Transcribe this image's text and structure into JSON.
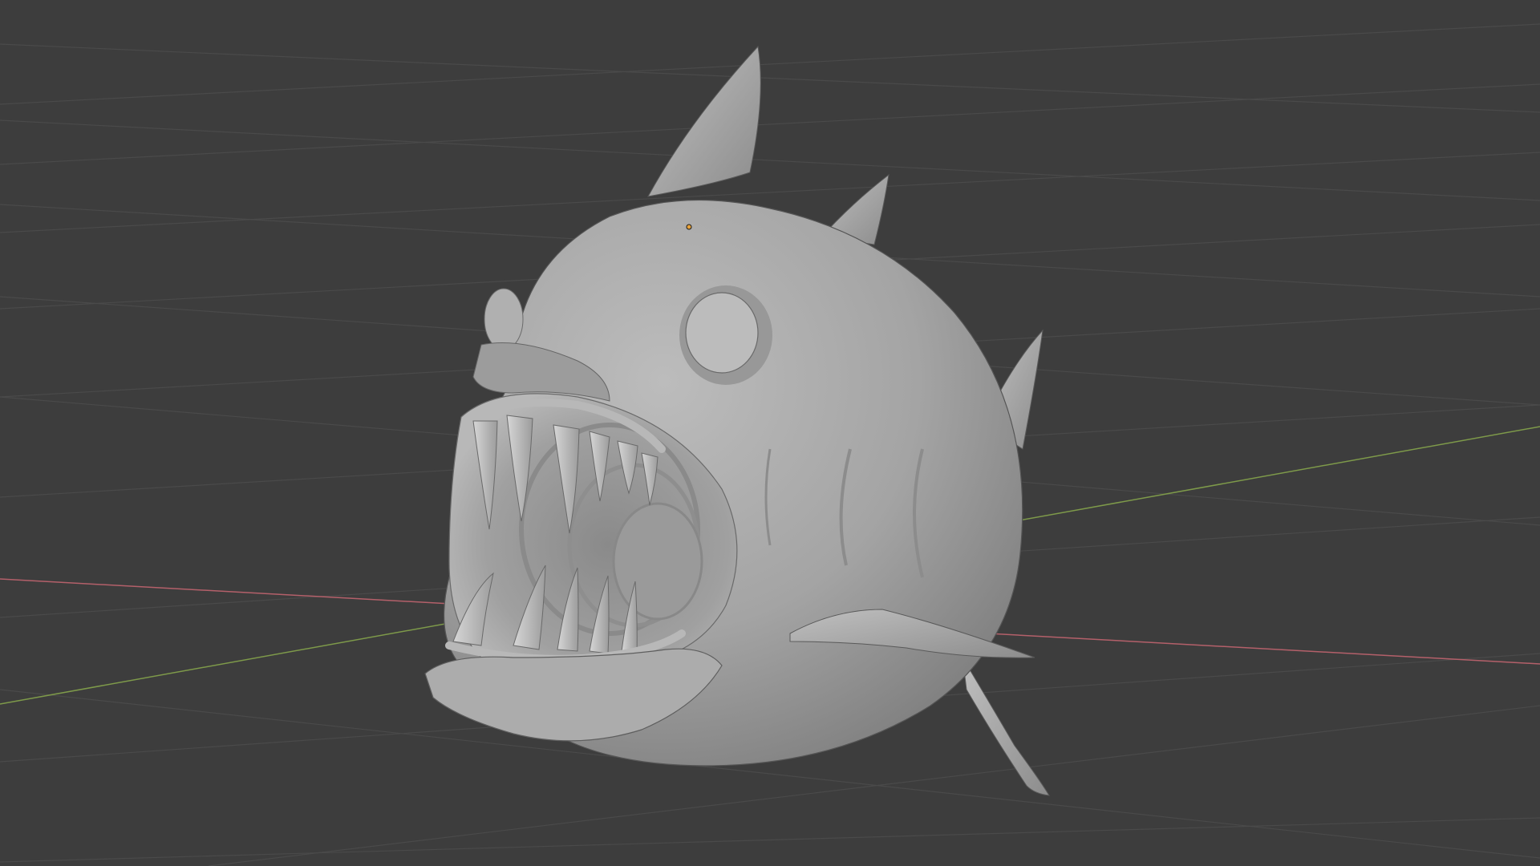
{
  "viewport": {
    "background": "#3d3d3d",
    "grid_color": "#4a4a4a",
    "x_axis_color": "#b4606a",
    "y_axis_color": "#7e9a4a",
    "origin_color": "#e8a23a"
  },
  "mesh": {
    "subject": "fish-sculpt",
    "surface_color": "#a6a6a6",
    "shadow_color": "#6f6f6f",
    "highlight_color": "#c4c4c4"
  }
}
